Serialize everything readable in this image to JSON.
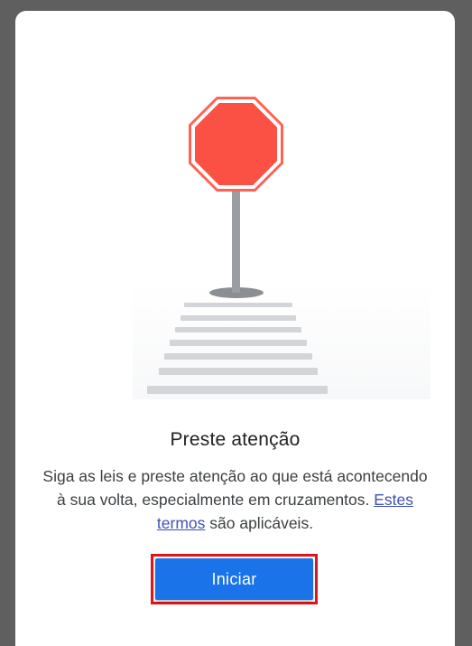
{
  "dialog": {
    "title": "Preste atenção",
    "body_before_link": "Siga as leis e preste atenção ao que está acontecendo à sua volta, especialmente em cruzamentos. ",
    "link_text": "Estes termos",
    "body_after_link": " são aplicáveis.",
    "start_button_label": "Iniciar"
  },
  "illustration": {
    "subject": "stop-sign-with-crosswalk",
    "colors": {
      "sign_red": "#fb5145",
      "sign_border": "#ffffff",
      "pole": "#8b8e92",
      "crosswalk": "#d3d5d8"
    }
  },
  "colors": {
    "accent": "#1a73e8",
    "link": "#3f51b5",
    "highlight_box": "#e0151c",
    "backdrop": "#5f5f5f"
  }
}
